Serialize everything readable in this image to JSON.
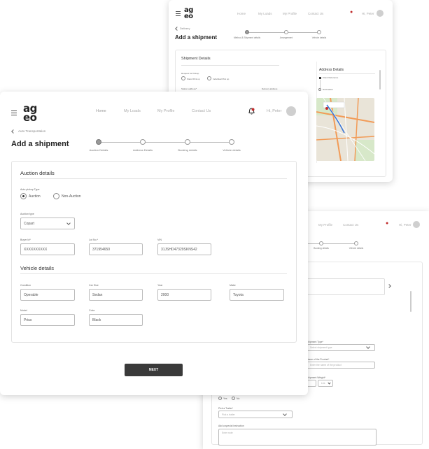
{
  "logo": {
    "line1": "ag",
    "line2": "eo"
  },
  "colors": {
    "accent": "#c02a2a",
    "button": "#3a3a3a",
    "map_road": "#f29b57",
    "map_bg": "#e9e4d8"
  },
  "top": {
    "nav": [
      "Home",
      "My Loads",
      "My Profile",
      "Contact Us"
    ],
    "greeting": "Hi, Peter",
    "breadcrumb": "Delivery",
    "title": "Add a shipment",
    "steps": [
      "Method & Shipment details",
      "Arrangement",
      "Vehicle details"
    ],
    "section_title": "Shipment Details",
    "pickup_label": "Request for Pickup",
    "pickup_options": [
      "Stand Pick up",
      "Individual Pick up"
    ],
    "small_labels": [
      "Station address*",
      "Delivery address"
    ],
    "address_panel": {
      "title": "Address Details",
      "origin_label": "Client Reference",
      "destination_label": "Destination"
    }
  },
  "main": {
    "nav": [
      "Home",
      "My Loads",
      "My Profile",
      "Contact Us"
    ],
    "greeting": "Hi, Peter",
    "breadcrumb": "Auto Transportation",
    "title": "Add a shipment",
    "steps": [
      "Auction Details",
      "Address Details",
      "Booking details",
      "Vehicle details"
    ],
    "auction_section": "Auction details",
    "pickup_type_label": "Auto pickup Type",
    "pickup_options": [
      "Auction",
      "Non-Auction"
    ],
    "auction_type_label": "Auction type",
    "auction_type_value": "Copart",
    "buyer_label": "Buyer Id*",
    "buyer_value": "XXXXXXXXXX",
    "lot_label": "Lot No.*",
    "lot_value": "371954650",
    "vin_label": "VIN",
    "vin_value": "31JSHD47329SKNS42",
    "vehicle_section": "Vehicle details",
    "condition_label": "Condition",
    "condition_value": "Operable",
    "carsize_label": "Car Size",
    "carsize_value": "Sedan",
    "year_label": "Year",
    "year_value": "2000",
    "make_label": "Make",
    "make_value": "Toyota",
    "model_label": "Model",
    "model_value": "Prius",
    "color_label": "Color",
    "color_value": "Black",
    "next_label": "NEXT"
  },
  "bottom": {
    "nav": [
      "My Profile",
      "Contact Us"
    ],
    "greeting": "Hi, Peter",
    "steps": [
      "Booking details",
      "Vehicle details"
    ],
    "shipment_type_label": "Shipment Type*",
    "shipment_type_placeholder": "Select shipment type",
    "product_label": "Name of the Product*",
    "product_placeholder": "Enter the name of the product",
    "weight_label": "Shipment Weight*",
    "weight_unit": "Lbs",
    "yesno": [
      "Yes",
      "No"
    ],
    "trailer_label": "Pick a Trailer*",
    "trailer_placeholder": "Pick a trailer",
    "instruction_label": "Add a special instruction",
    "instruction_placeholder": "Enter note"
  }
}
